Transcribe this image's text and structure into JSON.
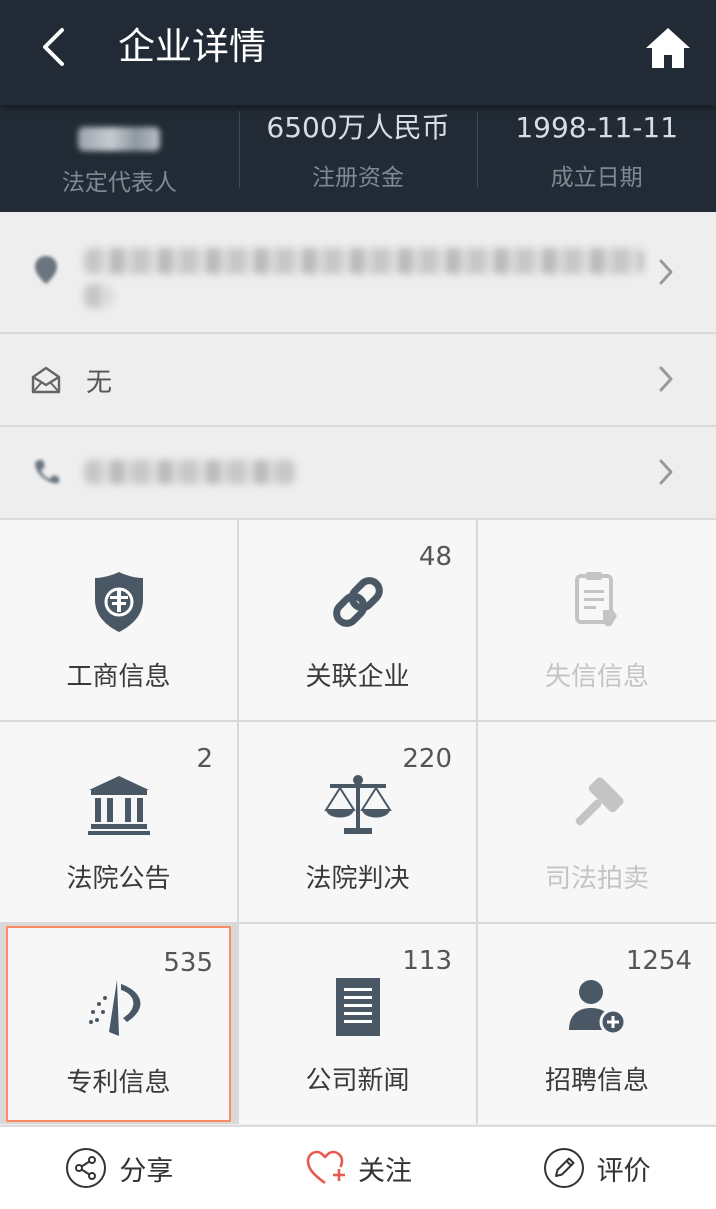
{
  "header": {
    "title": "企业详情"
  },
  "info": {
    "capital_value": "6500万人民币",
    "capital_label": "注册资金",
    "date_value": "1998-11-11",
    "date_label": "成立日期",
    "rep_label": "法定代表人"
  },
  "email": {
    "value": "无"
  },
  "grid": [
    {
      "label": "工商信息",
      "badge": ""
    },
    {
      "label": "关联企业",
      "badge": "48"
    },
    {
      "label": "失信信息",
      "badge": ""
    },
    {
      "label": "法院公告",
      "badge": "2"
    },
    {
      "label": "法院判决",
      "badge": "220"
    },
    {
      "label": "司法拍卖",
      "badge": ""
    },
    {
      "label": "专利信息",
      "badge": "535"
    },
    {
      "label": "公司新闻",
      "badge": "113"
    },
    {
      "label": "招聘信息",
      "badge": "1254"
    }
  ],
  "bottom": {
    "share": "分享",
    "follow": "关注",
    "review": "评价"
  },
  "colors": {
    "header_bg": "#222b35",
    "icon_gray": "#4a5866",
    "accent": "#e85a4f",
    "selected_border": "#ff8a65"
  }
}
